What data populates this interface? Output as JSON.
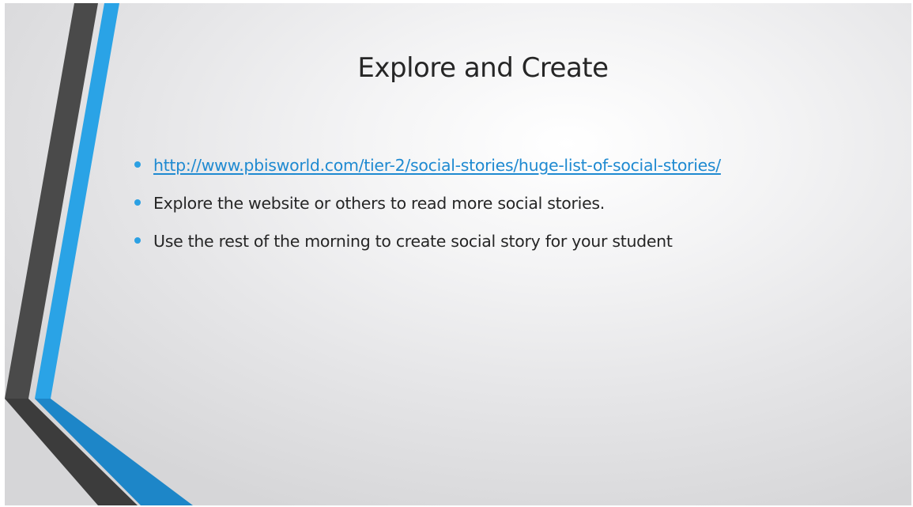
{
  "slide": {
    "title": "Explore and Create",
    "bullets": [
      {
        "text": "http://www.pbisworld.com/tier-2/social-stories/huge-list-of-social-stories/",
        "is_link": true
      },
      {
        "text": "Explore the website or others to read more social stories.",
        "is_link": false
      },
      {
        "text": "Use the rest of the morning to create social story for your student",
        "is_link": false
      }
    ]
  },
  "theme": {
    "accent_blue": "#2ba0e3",
    "dark_gray": "#4a4a4a",
    "link_color": "#1f8ad1",
    "text_color": "#262626"
  }
}
